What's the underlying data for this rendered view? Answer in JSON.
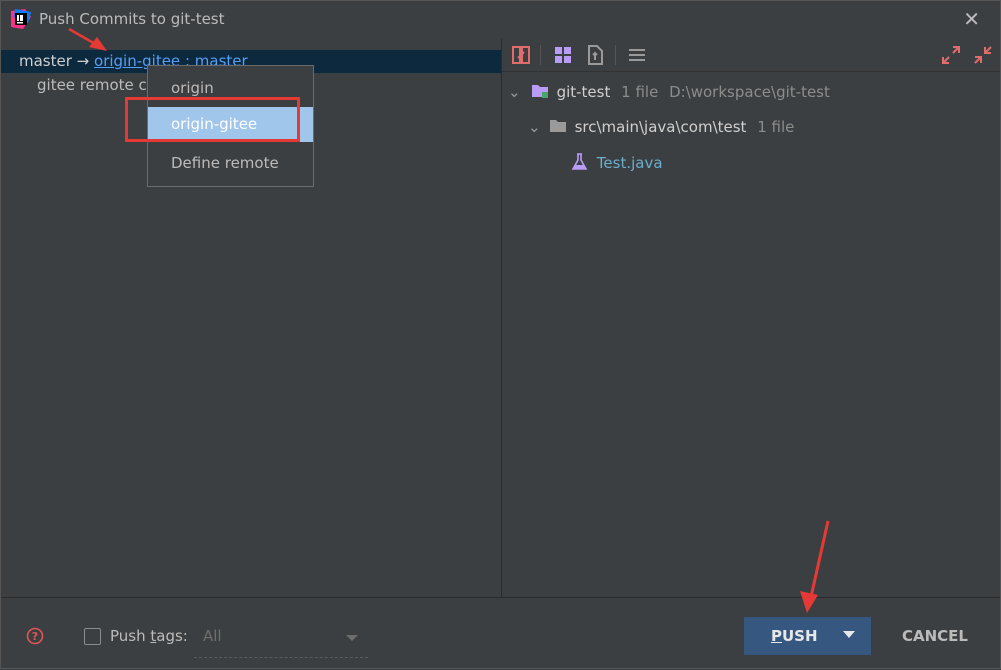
{
  "window": {
    "title": "Push Commits to git-test",
    "close_glyph": "✕"
  },
  "left": {
    "branch": {
      "local": "master",
      "arrow": " → ",
      "remote": "origin-gitee",
      "separator": " : ",
      "target": "master"
    },
    "sub_item": "gitee remote co"
  },
  "remote_menu": {
    "items": [
      "origin",
      "origin-gitee",
      "Define remote"
    ],
    "selected": "origin-gitee"
  },
  "right": {
    "toolbar_icons": [
      "diff-icon",
      "group-by-icon",
      "show-changes-icon",
      "options-icon",
      "expand-all-icon",
      "collapse-all-icon"
    ],
    "tree": {
      "repo": {
        "name": "git-test",
        "count": "1 file",
        "path": "D:\\workspace\\git-test"
      },
      "folder": {
        "name": "src\\main\\java\\com\\test",
        "count": "1 file"
      },
      "file": {
        "name": "Test.java"
      }
    }
  },
  "footer": {
    "push_tags_prefix": "Push ",
    "push_tags_mnemonic": "t",
    "push_tags_suffix": "ags:",
    "tags_value": "All",
    "push_mnemonic": "P",
    "push_rest": "USH",
    "cancel_label": "CANCEL"
  },
  "colors": {
    "background": "#3c3f41",
    "selection": "#0d293e",
    "link": "#589df6",
    "menu_selected": "#a1c6ec",
    "push_button": "#365880",
    "annotation": "#e53935"
  }
}
